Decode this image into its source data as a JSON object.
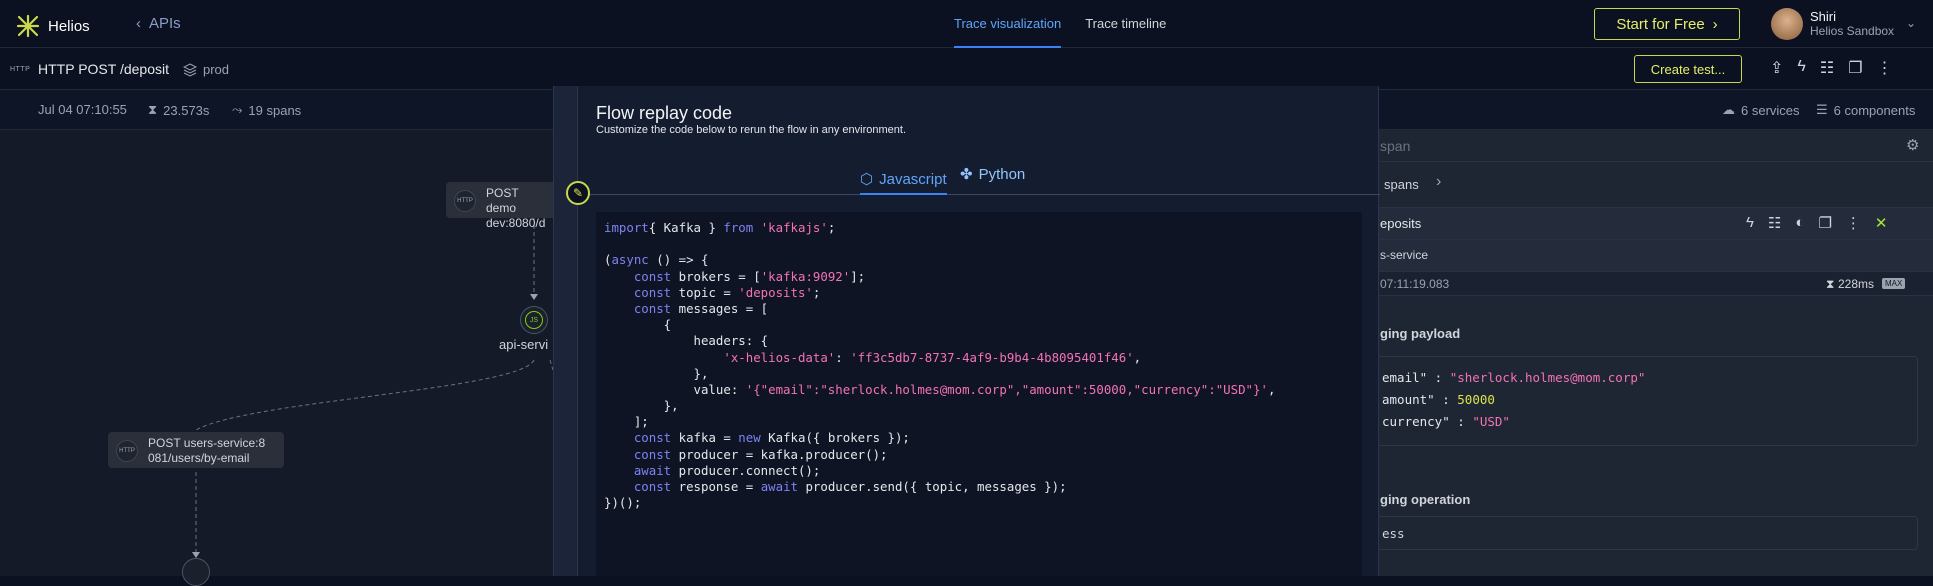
{
  "app": {
    "name": "Helios",
    "back_label": "APIs"
  },
  "tabs": [
    {
      "label": "Trace visualization",
      "active": true
    },
    {
      "label": "Trace timeline",
      "active": false
    }
  ],
  "header": {
    "start_button": "Start for Free",
    "user_name": "Shiri",
    "user_org": "Helios Sandbox"
  },
  "trace": {
    "http_tag": "HTTP",
    "endpoint": "HTTP POST /deposit",
    "env": "prod",
    "create_test": "Create test...",
    "date": "Jul 04 07:10:55",
    "duration": "23.573s",
    "spans": "19 spans",
    "services": "6 services",
    "components": "6 components"
  },
  "graph": {
    "node1_line1": "POST demo",
    "node1_line2": "dev:8080/d",
    "node_tag": "HTTP",
    "api_service": "api-servi",
    "node2_line1": "POST users-service:8",
    "node2_line2": "081/users/by-email",
    "js_badge": "JS"
  },
  "right_panel": {
    "search_placeholder": "span",
    "spans_link": "spans",
    "topic": "eposits",
    "service": "s-service",
    "timestamp": "07:11:19.083",
    "span_duration": "228ms",
    "max_badge": "MAX",
    "payload_header": "ging payload",
    "payload_email_key": "email\"",
    "payload_email_val": "\"sherlock.holmes@mom.corp\"",
    "payload_amount_key": "amount\"",
    "payload_amount_val": "50000",
    "payload_currency_key": "currency\"",
    "payload_currency_val": "\"USD\"",
    "operation_header": "ging operation",
    "operation_val": "ess"
  },
  "modal": {
    "title": "Flow replay code",
    "subtitle": "Customize the code below to rerun the flow in any environment.",
    "tab_js": "Javascript",
    "tab_py": "Python",
    "code": [
      [
        [
          "kw",
          "import"
        ],
        [
          "",
          "{ Kafka } "
        ],
        [
          "kw",
          "from"
        ],
        [
          "",
          " "
        ],
        [
          "st",
          "'kafkajs'"
        ],
        [
          "",
          ";"
        ]
      ],
      [],
      [
        [
          "",
          "("
        ],
        [
          "kw",
          "async"
        ],
        [
          "",
          " () => {"
        ]
      ],
      [
        [
          "",
          "    "
        ],
        [
          "kw",
          "const"
        ],
        [
          "",
          " brokers = ["
        ],
        [
          "st",
          "'kafka:9092'"
        ],
        [
          "",
          "];"
        ]
      ],
      [
        [
          "",
          "    "
        ],
        [
          "kw",
          "const"
        ],
        [
          "",
          " topic = "
        ],
        [
          "st",
          "'deposits'"
        ],
        [
          "",
          ";"
        ]
      ],
      [
        [
          "",
          "    "
        ],
        [
          "kw",
          "const"
        ],
        [
          "",
          " messages = ["
        ]
      ],
      [
        [
          "",
          "        {"
        ]
      ],
      [
        [
          "",
          "            headers: {"
        ]
      ],
      [
        [
          "",
          "                "
        ],
        [
          "st",
          "'x-helios-data'"
        ],
        [
          "",
          ": "
        ],
        [
          "st",
          "'ff3c5db7-8737-4af9-b9b4-4b8095401f46'"
        ],
        [
          "",
          ","
        ]
      ],
      [
        [
          "",
          "            },"
        ]
      ],
      [
        [
          "",
          "            value: "
        ],
        [
          "st",
          "'{\"email\":\"sherlock.holmes@mom.corp\",\"amount\":50000,\"currency\":\"USD\"}'"
        ],
        [
          "",
          ","
        ]
      ],
      [
        [
          "",
          "        },"
        ]
      ],
      [
        [
          "",
          "    ];"
        ]
      ],
      [
        [
          "",
          "    "
        ],
        [
          "kw",
          "const"
        ],
        [
          "",
          " kafka = "
        ],
        [
          "kw",
          "new"
        ],
        [
          "",
          " Kafka({ brokers });"
        ]
      ],
      [
        [
          "",
          "    "
        ],
        [
          "kw",
          "const"
        ],
        [
          "",
          " producer = kafka.producer();"
        ]
      ],
      [
        [
          "",
          "    "
        ],
        [
          "kw",
          "await"
        ],
        [
          "",
          " producer.connect();"
        ]
      ],
      [
        [
          "",
          "    "
        ],
        [
          "kw",
          "const"
        ],
        [
          "",
          " response = "
        ],
        [
          "kw",
          "await"
        ],
        [
          "",
          " producer.send({ topic, messages });"
        ]
      ],
      [
        [
          "",
          "})();"
        ]
      ]
    ]
  }
}
